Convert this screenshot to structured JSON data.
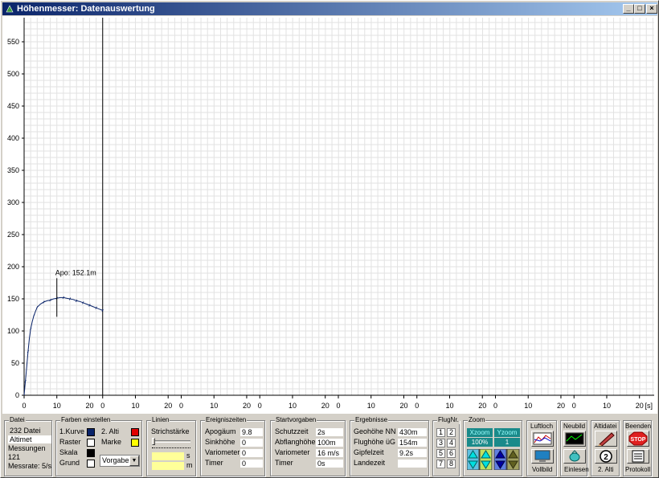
{
  "window": {
    "title": "Höhenmesser: Datenauswertung",
    "buttons": [
      "_",
      "□",
      "×"
    ]
  },
  "plot": {
    "apogee_label": "Apo: 152.1m",
    "y_ticks": [
      0,
      50,
      100,
      150,
      200,
      250,
      300,
      350,
      400,
      450,
      500,
      550
    ],
    "x_segment_ticks": [
      "0",
      "10",
      "20"
    ],
    "x_unit": "[s]",
    "segments": 8
  },
  "chart_data": {
    "type": "line",
    "xlabel": "[s]",
    "ylabel": "",
    "xlim": [
      0,
      24
    ],
    "ylim": [
      0,
      580
    ],
    "x": [
      0,
      0.4,
      0.8,
      1.2,
      1.6,
      2.0,
      2.5,
      3,
      3.5,
      4,
      5,
      6,
      7,
      8,
      9,
      10,
      11,
      12,
      13,
      14,
      15,
      16,
      17,
      18,
      19,
      20,
      21,
      22,
      23,
      24
    ],
    "y": [
      0,
      22,
      45,
      68,
      88,
      103,
      115,
      124,
      131,
      137,
      142,
      145,
      147,
      148,
      150,
      151,
      152,
      152,
      151,
      150,
      149,
      147,
      146,
      144,
      142,
      140,
      138,
      136,
      134,
      132
    ],
    "annotation": {
      "x": 10,
      "y": 152.1,
      "text": "Apo: 152.1m"
    }
  },
  "datei": {
    "caption": "Datei",
    "rows": [
      "232 Datei",
      "Altimet",
      "Messungen",
      "121",
      "Messrate: 5/s"
    ]
  },
  "farben": {
    "caption": "Farben einstellen",
    "labels": [
      "1.Kurve",
      "Raster",
      "Skala",
      "Grund",
      "2. Alti",
      "Marke"
    ],
    "colors": [
      "#0a246a",
      "#ffffff",
      "#000000",
      "#ffffff",
      "#e00000",
      "#ffff00"
    ],
    "select": "Vorgabe"
  },
  "linien": {
    "caption": "Linien",
    "label": "Strichstärke",
    "unit_s": "s",
    "unit_m": "m"
  },
  "ereignis": {
    "caption": "Ereigniszeiten",
    "rows": [
      {
        "label": "Apogäum",
        "value": "9.8"
      },
      {
        "label": "Sinkhöhe",
        "value": "0"
      },
      {
        "label": "Variometer",
        "value": "0"
      },
      {
        "label": "Timer",
        "value": "0"
      }
    ]
  },
  "start": {
    "caption": "Startvorgaben",
    "rows": [
      {
        "label": "Schutzzeit",
        "value": "2s"
      },
      {
        "label": "Abflanghöhe",
        "value": "100m"
      },
      {
        "label": "Variometer",
        "value": "16 m/s"
      },
      {
        "label": "Timer",
        "value": "0s"
      }
    ]
  },
  "ergebnisse": {
    "caption": "Ergebnisse",
    "rows": [
      {
        "label": "Geohöhe NN",
        "value": "430m"
      },
      {
        "label": "Flughöhe üG",
        "value": "154m"
      },
      {
        "label": "Gipfelzeit",
        "value": "9.2s"
      },
      {
        "label": "Landezeit",
        "value": ""
      }
    ]
  },
  "flugnr": {
    "caption": "FlugNr.",
    "buttons": [
      "1",
      "2",
      "3",
      "4",
      "5",
      "6",
      "7",
      "8"
    ]
  },
  "zoom": {
    "caption": "Zoom",
    "xzoom": "Xzoom",
    "yzoom": "Yzoom",
    "pct": "100%",
    "y_val": "1"
  },
  "luftloch": {
    "caption": "Luftloch",
    "btn": "Vollbild"
  },
  "neubild": {
    "caption": "Neubild",
    "btn": "Einlesen"
  },
  "altidatei": {
    "caption": "Altidatei",
    "btn": "2. Alti"
  },
  "beenden": {
    "caption": "Beenden",
    "stop": "STOP",
    "btn": "Protokoll"
  }
}
